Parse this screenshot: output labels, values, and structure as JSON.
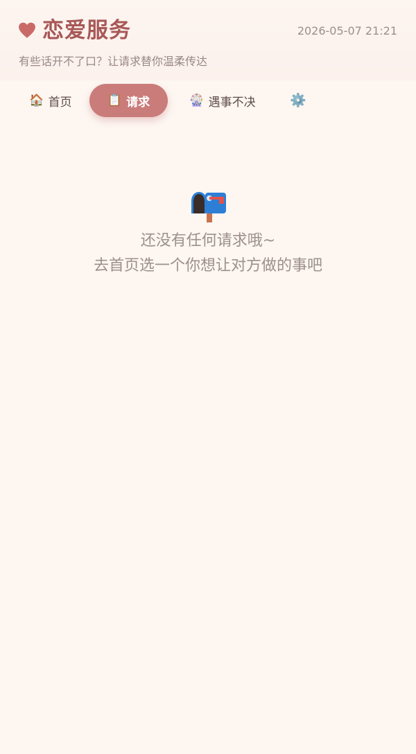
{
  "header": {
    "title": "恋爱服务",
    "datetime": "2026-05-07 21:21",
    "subtitle": "有些话开不了口？让请求替你温柔传达",
    "logo_icon": "heart-icon",
    "title_color": "#a85858"
  },
  "nav": {
    "tabs": [
      {
        "label": "首页",
        "icon": "house-icon",
        "glyph": "🏠",
        "active": false
      },
      {
        "label": "请求",
        "icon": "clipboard-icon",
        "glyph": "📋",
        "active": true
      },
      {
        "label": "遇事不决",
        "icon": "ferris-wheel-icon",
        "glyph": "🎡",
        "active": false
      },
      {
        "label": "",
        "icon": "gear-icon",
        "glyph": "⚙️",
        "active": false
      }
    ],
    "active_color": "#c97c7a"
  },
  "empty_state": {
    "icon": "mailbox-icon",
    "line1": "还没有任何请求哦~",
    "line2": "去首页选一个你想让对方做的事吧"
  },
  "colors": {
    "background": "#fdf6f1",
    "accent": "#c97c7a"
  }
}
